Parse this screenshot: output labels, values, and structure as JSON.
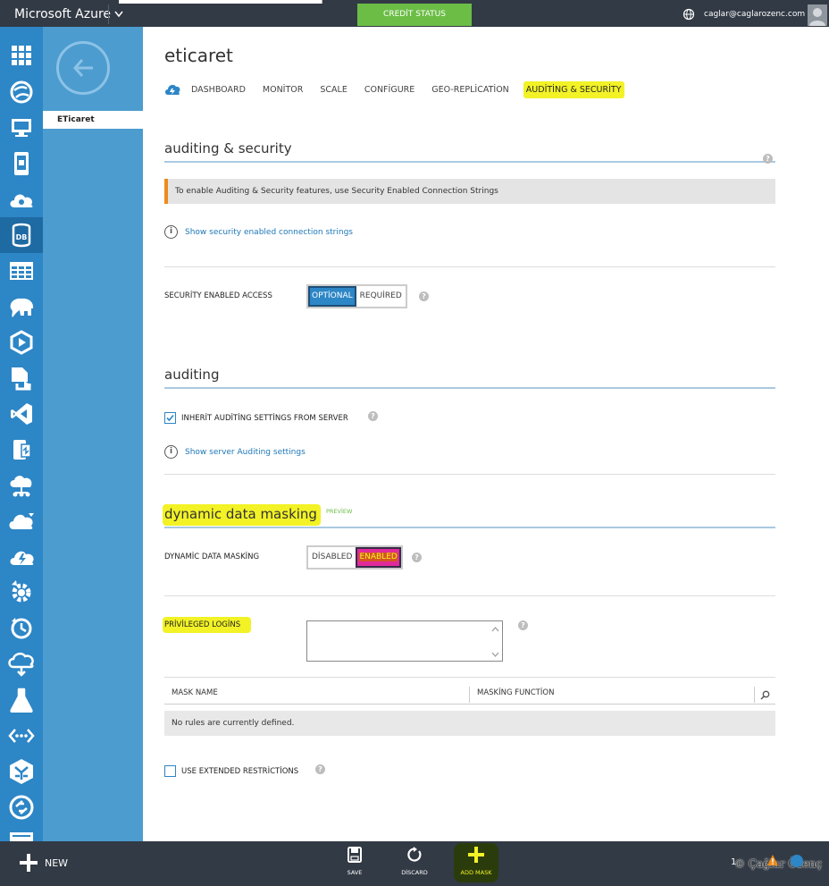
{
  "topbar": {
    "brand": "Microsoft Azure",
    "credit_status": "CREDİT STATUS",
    "user_email": "caglar@caglarozenc.com"
  },
  "rail": {
    "icons": [
      "all-items-icon",
      "web-sites-icon",
      "virtual-machines-icon",
      "mobile-services-icon",
      "cloud-services-icon",
      "sql-databases-icon",
      "storage-icon",
      "hdinsight-icon",
      "media-services-icon",
      "service-bus-icon",
      "visual-studio-online-icon",
      "cache-icon",
      "biztalk-services-icon",
      "recovery-services-icon",
      "automation-icon",
      "scheduler-icon",
      "api-management-icon",
      "machine-learning-icon",
      "stream-analytics-icon",
      "networks-icon",
      "traffic-manager-icon",
      "remoteapp-icon",
      "management-services-icon"
    ],
    "active_index": 5
  },
  "secnav": {
    "item": "ETicaret"
  },
  "page": {
    "title": "eticaret",
    "tabs": [
      "DASHBOARD",
      "MONİTOR",
      "SCALE",
      "CONFİGURE",
      "GEO-REPLİCATİON",
      "AUDİTİNG & SECURİTY"
    ],
    "active_tab": "AUDİTİNG & SECURİTY"
  },
  "auditing_security": {
    "heading": "auditing & security",
    "notice": "To enable Auditing & Security features, use Security Enabled Connection Strings",
    "link": "Show security enabled connection strings",
    "access_label": "SECURİTY ENABLED ACCESS",
    "access_options": [
      "OPTİONAL",
      "REQUİRED"
    ],
    "access_selected": "OPTİONAL"
  },
  "auditing": {
    "heading": "auditing",
    "inherit_label": "INHERİT AUDİTİNG SETTİNGS FROM SERVER",
    "inherit_checked": true,
    "link": "Show server Auditing settings"
  },
  "masking": {
    "heading": "dynamic data masking",
    "badge": "PREVİEW",
    "toggle_label": "DYNAMİC DATA MASKİNG",
    "toggle_options": [
      "DİSABLED",
      "ENABLED"
    ],
    "toggle_selected": "ENABLED",
    "logins_label": "PRİVİLEGED LOGİNS",
    "logins_value": "",
    "table_columns": [
      "MASK NAME",
      "MASKİNG FUNCTİON"
    ],
    "empty_message": "No rules are currently defined.",
    "extended_label": "USE EXTENDED RESTRİCTİONS",
    "extended_checked": false
  },
  "bottombar": {
    "new_label": "NEW",
    "commands": [
      {
        "label": "SAVE",
        "icon": "save-icon"
      },
      {
        "label": "DİSCARD",
        "icon": "discard-icon"
      },
      {
        "label": "ADD MASK",
        "icon": "add-icon"
      }
    ],
    "count": "1",
    "watermark": "© Çağlar Özenç"
  },
  "colors": {
    "accent": "#2d86c6",
    "chrome": "#323a45",
    "highlight": "#f2f226",
    "credit": "#6bbd46"
  }
}
